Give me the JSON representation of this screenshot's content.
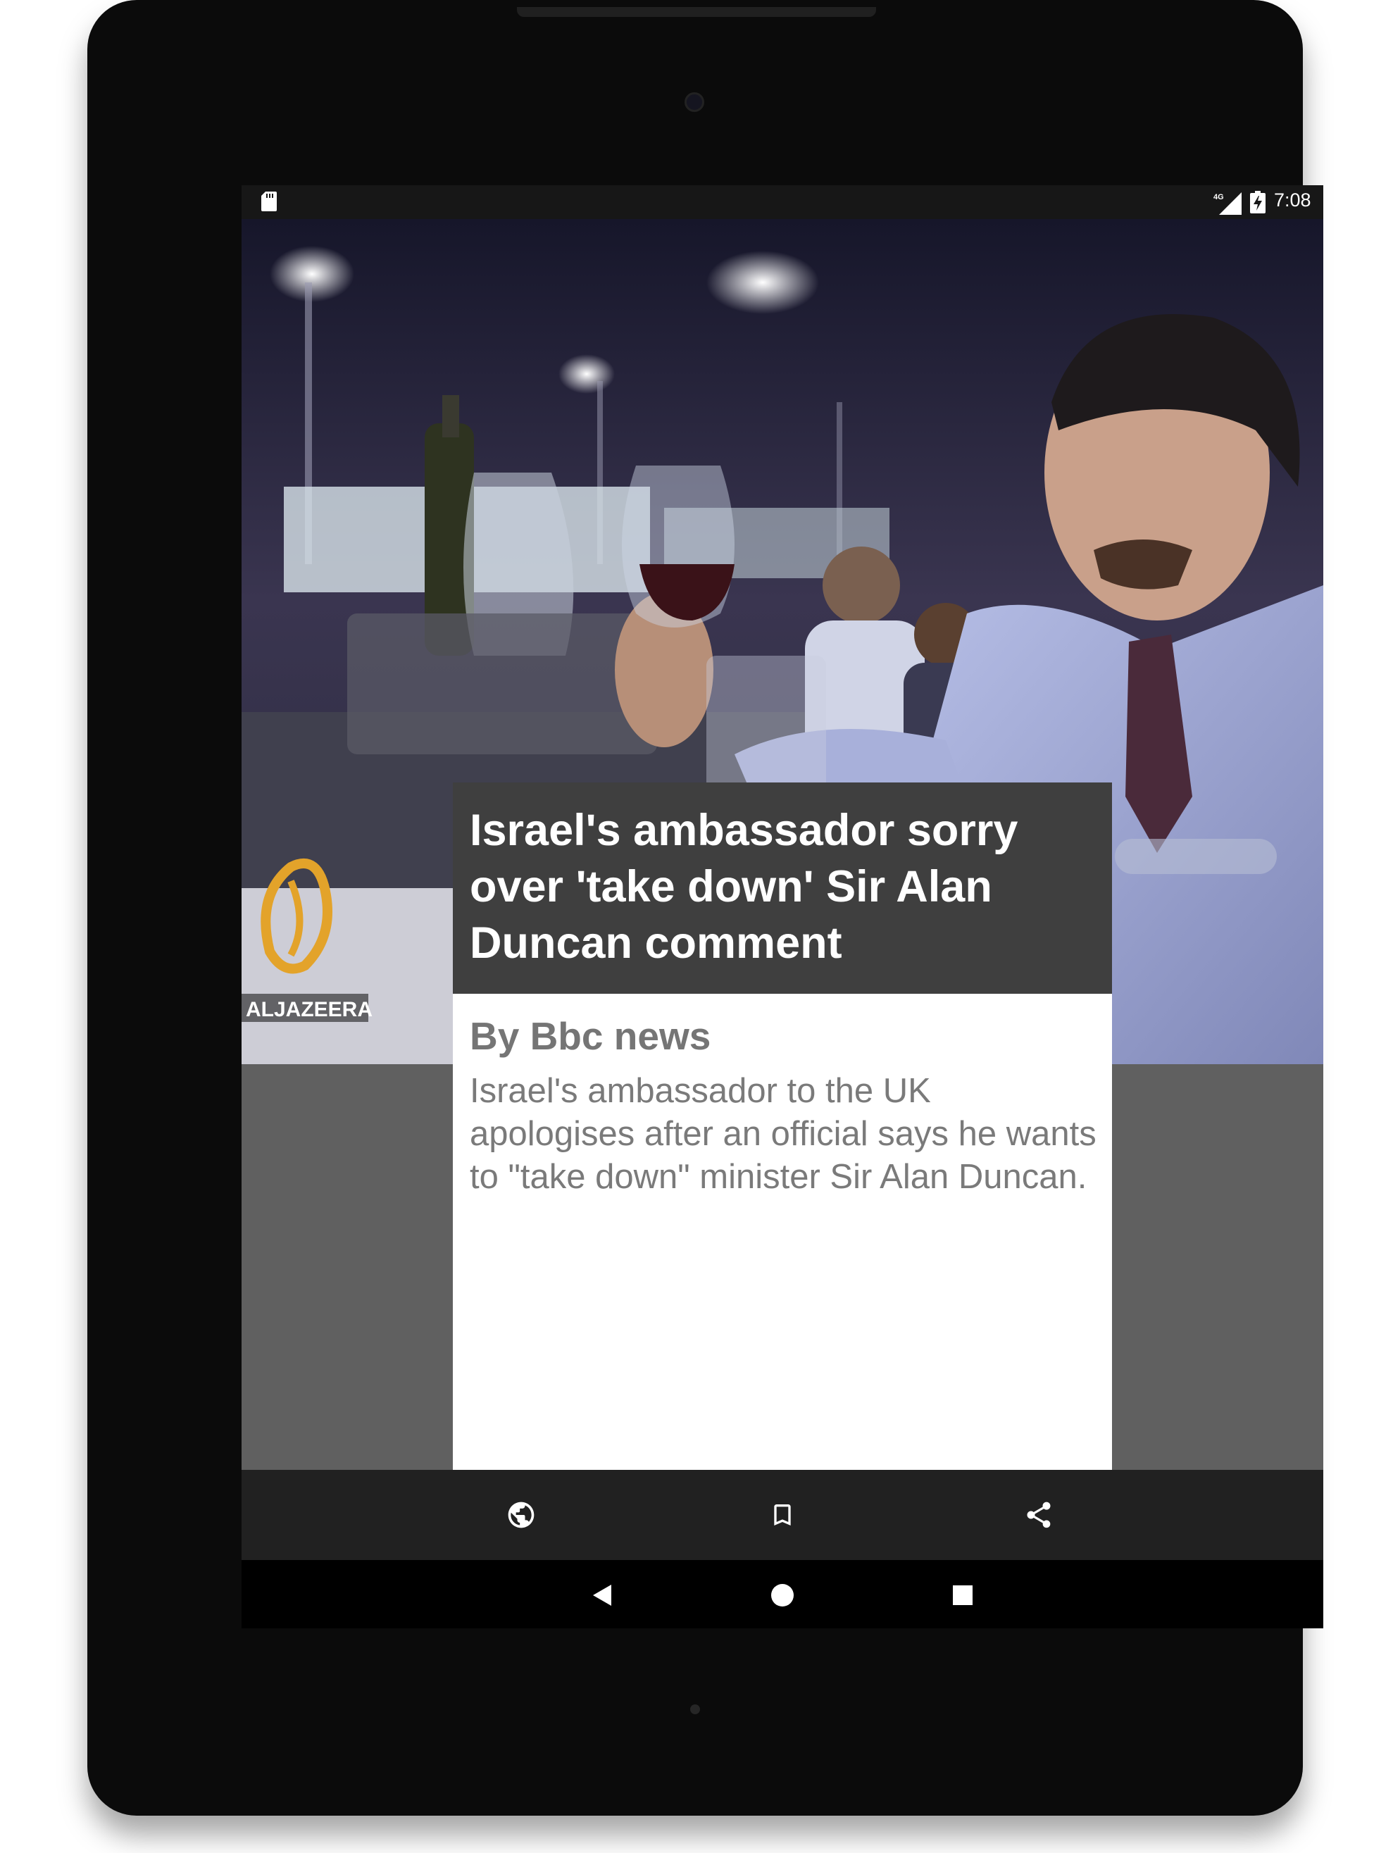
{
  "status_bar": {
    "time": "7:08",
    "network_label": "4G",
    "icons": [
      "sd-card-icon",
      "signal-icon",
      "battery-charging-icon"
    ]
  },
  "hero": {
    "watermark_text": "ALJAZEERA",
    "description": "Photo of a man in a restaurant holding a glass of red wine"
  },
  "article": {
    "title": "Israel's ambassador sorry over 'take down' Sir Alan Duncan comment",
    "byline": "By Bbc news",
    "summary": "Israel's ambassador to the UK apologises after an official says he wants to \"take down\" minister Sir Alan Duncan."
  },
  "action_bar": {
    "buttons": [
      "globe-icon",
      "bookmark-icon",
      "share-icon"
    ]
  },
  "nav_bar": {
    "buttons": [
      "back-icon",
      "home-icon",
      "recents-icon"
    ]
  },
  "colors": {
    "title_background": "#3f3f3f",
    "content_background": "#606060",
    "action_bar_background": "#212121",
    "text_muted": "#757575"
  }
}
